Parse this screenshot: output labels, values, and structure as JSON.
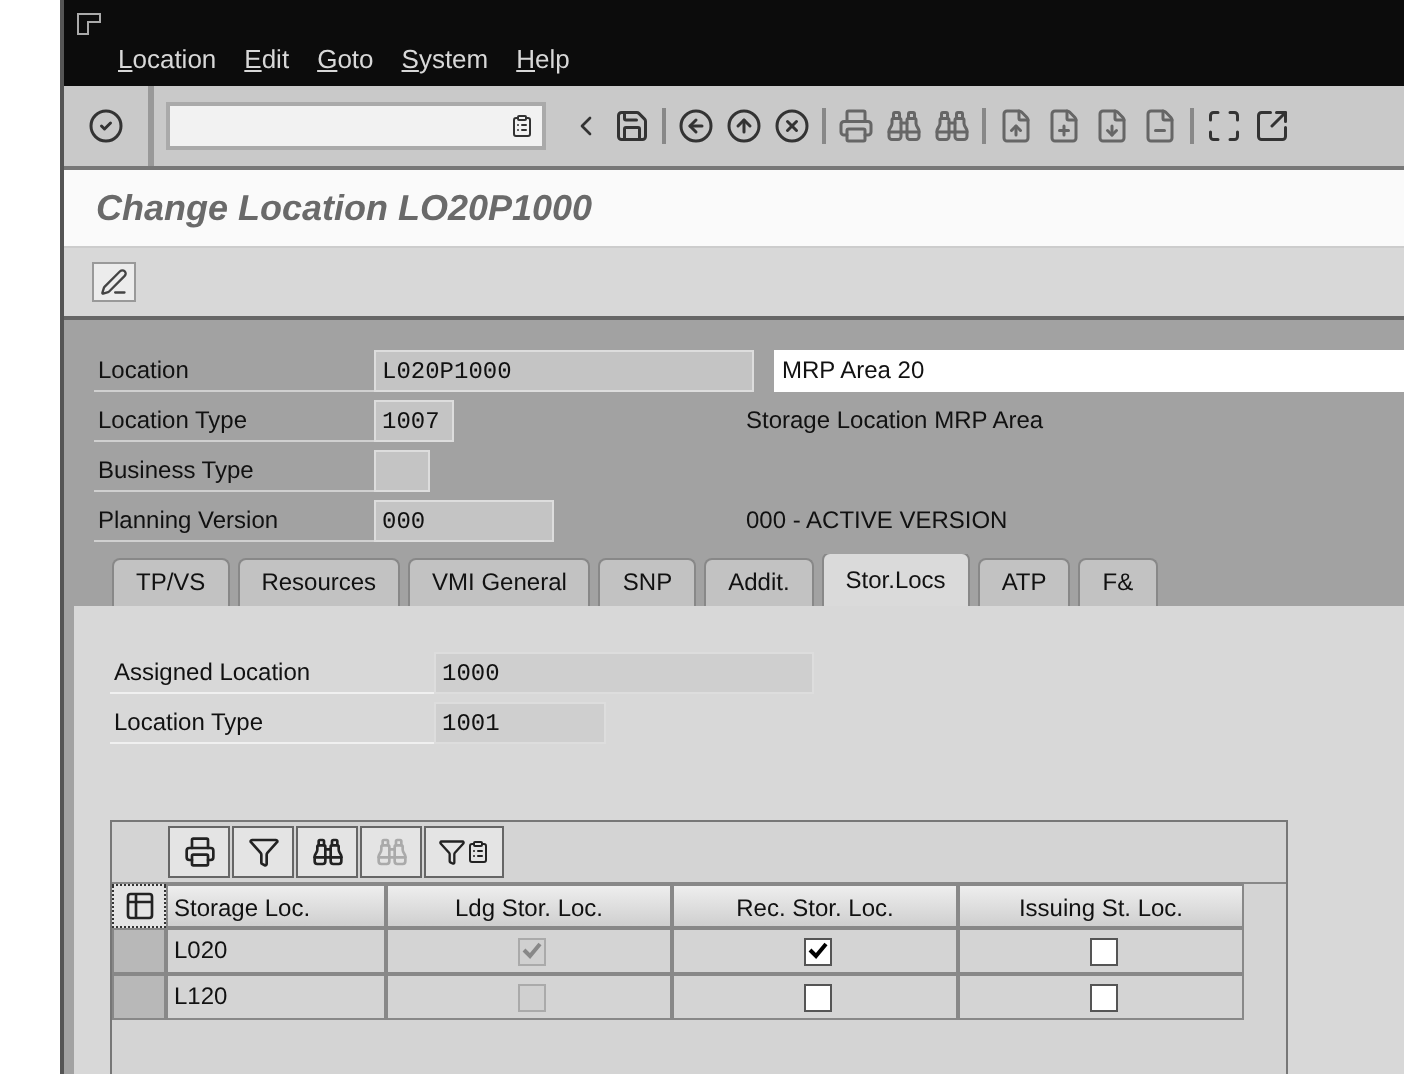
{
  "menu_bar": {
    "items": [
      "Location",
      "Edit",
      "Goto",
      "System",
      "Help"
    ]
  },
  "screen_title": "Change Location LO20P1000",
  "header_fields": [
    {
      "label": "Location",
      "value": "L020P1000",
      "description_field": "MRP Area 20"
    },
    {
      "label": "Location Type",
      "value": "1007",
      "description": "Storage Location MRP Area"
    },
    {
      "label": "Business Type"
    },
    {
      "label": "Planning Version",
      "value": "000",
      "description": "000 - ACTIVE VERSION"
    }
  ],
  "tabs": [
    {
      "label": "TP/VS",
      "selected": false
    },
    {
      "label": "Resources",
      "selected": false
    },
    {
      "label": "VMI General",
      "selected": false
    },
    {
      "label": "SNP",
      "selected": false
    },
    {
      "label": "Addit.",
      "selected": false
    },
    {
      "label": "Stor.Locs",
      "selected": true
    },
    {
      "label": "ATP",
      "selected": false
    },
    {
      "label": "F&",
      "selected": false
    }
  ],
  "tab_fields": [
    {
      "label": "Assigned Location",
      "value": "1000"
    },
    {
      "label": "Location Type",
      "value": "1001"
    }
  ],
  "table": {
    "columns": [
      "Storage Loc.",
      "Ldg Stor. Loc.",
      "Rec. Stor. Loc.",
      "Issuing St. Loc."
    ],
    "rows": [
      {
        "storage_loc": "L020",
        "flags": [
          {
            "checked": true,
            "disabled": true
          },
          {
            "checked": true,
            "disabled": false
          },
          {
            "checked": false,
            "disabled": false
          }
        ]
      },
      {
        "storage_loc": "L120",
        "flags": [
          {
            "checked": false,
            "disabled": true
          },
          {
            "checked": false,
            "disabled": false
          },
          {
            "checked": false,
            "disabled": false
          }
        ]
      }
    ]
  }
}
